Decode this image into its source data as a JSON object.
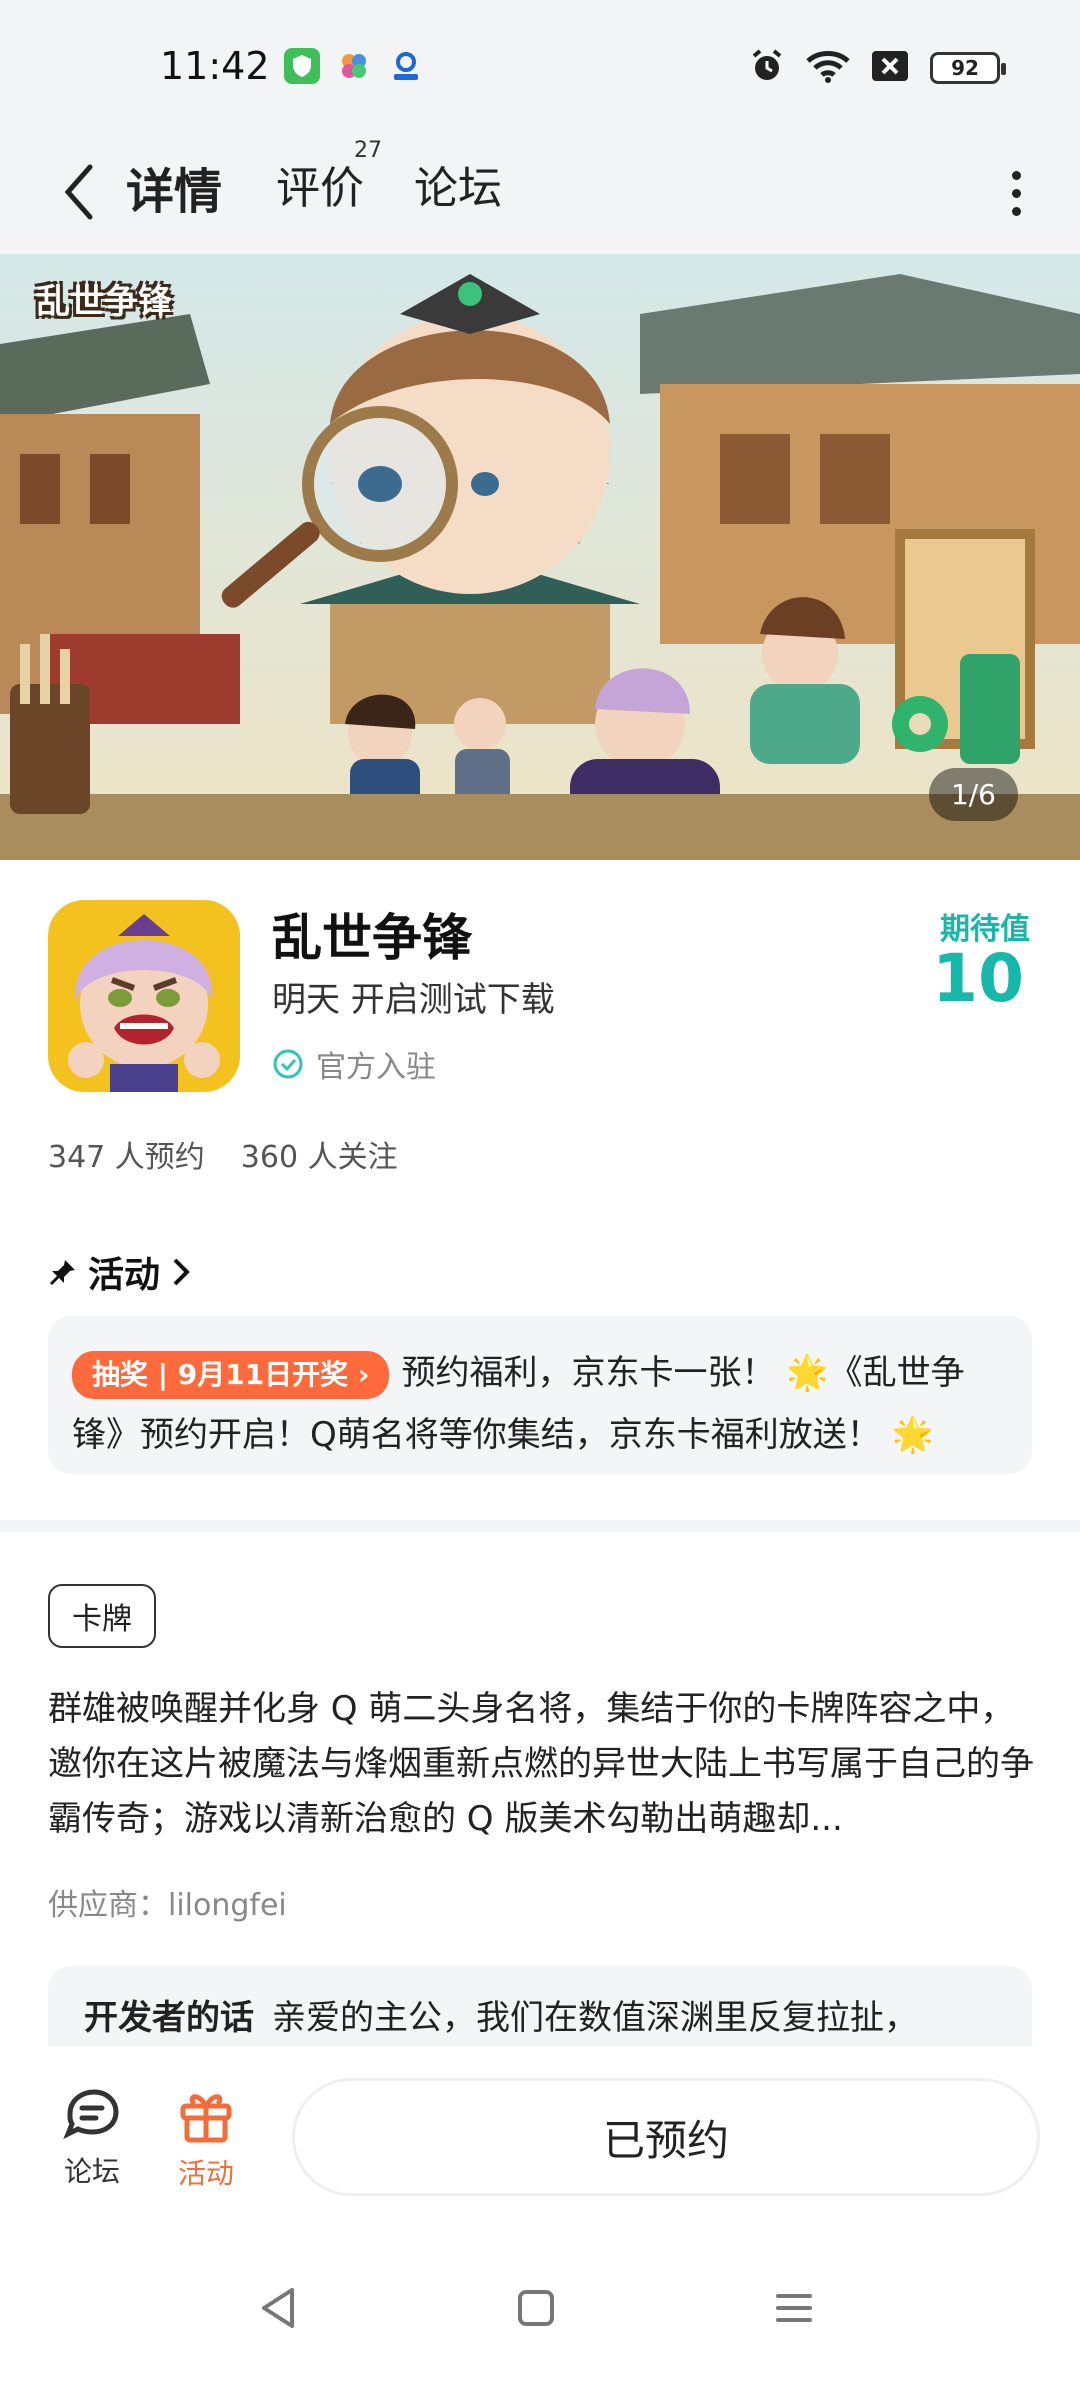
{
  "status_bar": {
    "time": "11:42",
    "battery": "92",
    "icons": [
      "shield-app-icon",
      "flower-app-icon",
      "location-app-icon",
      "alarm-icon",
      "wifi-icon",
      "sim-off-icon",
      "battery-icon"
    ]
  },
  "nav": {
    "tabs": [
      {
        "label": "详情",
        "active": true
      },
      {
        "label": "评价",
        "badge": "27"
      },
      {
        "label": "论坛"
      }
    ]
  },
  "banner": {
    "logo_text": "乱世争锋",
    "counter": "1/6"
  },
  "app": {
    "name": "乱世争锋",
    "launch_info": "明天 开启测试下载",
    "official": "官方入驻",
    "expectation_label": "期待值",
    "expectation_value": "10",
    "reservations": "347 人预约",
    "followers": "360 人关注"
  },
  "activity": {
    "header": "活动",
    "tag": "抽奖 | 9月11日开奖",
    "text": "预约福利，京东卡一张！ 🌟《乱世争锋》预约开启！Q萌名将等你集结，京东卡福利放送！ 🌟"
  },
  "details": {
    "genre_tag": "卡牌",
    "description": "群雄被唤醒并化身 Q 萌二头身名将，集结于你的卡牌阵容之中，邀你在这片被魔法与烽烟重新点燃的异世大陆上书写属于自己的争霸传奇；游戏以清新治愈的 Q 版美术勾勒出萌趣却...",
    "provider": "供应商：lilongfei",
    "developer_label": "开发者的话",
    "developer_text": "亲爱的主公，我们在数值深渊里反复拉扯，"
  },
  "bottom_bar": {
    "forum_label": "论坛",
    "activity_label": "活动",
    "reserve_button": "已预约"
  },
  "colors": {
    "accent_teal": "#17b7a9",
    "tab_underline": "#2ad1c1",
    "lottery_orange": "#ff6a3d",
    "activity_orange": "#f26d3a"
  }
}
